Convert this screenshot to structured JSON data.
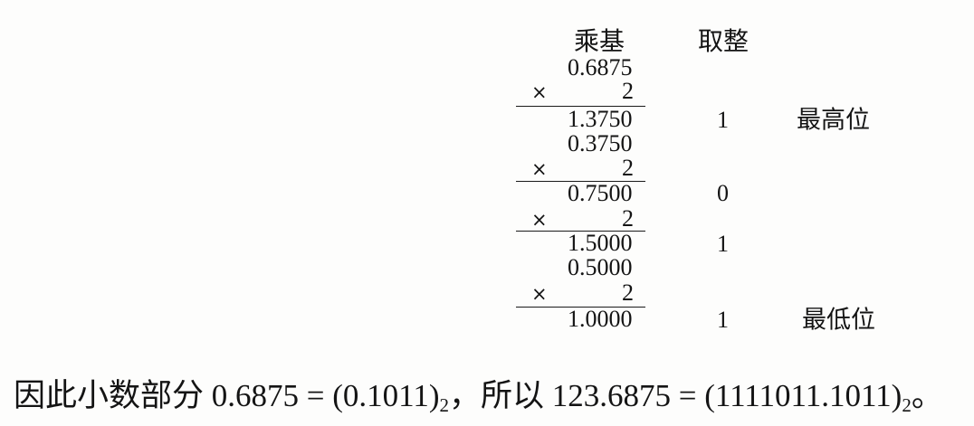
{
  "calc": {
    "header_multiply": "乘基",
    "header_integer": "取整",
    "times_symbol": "×",
    "base": "2",
    "steps": [
      {
        "multiplicand": "0.6875",
        "product": "1.3750",
        "integer": "1",
        "note": "最高位"
      },
      {
        "multiplicand": "0.3750",
        "product": "0.7500",
        "integer": "0"
      },
      {
        "product": "1.5000",
        "integer": "1"
      },
      {
        "multiplicand": "0.5000",
        "product": "1.0000",
        "integer": "1",
        "note": "最低位"
      }
    ]
  },
  "conclusion": {
    "text_1": "因此小数部分 0.6875 = (0.1011)",
    "subscript_1": "2",
    "text_2": "，所以 123.6875 = (1111011.1011)",
    "subscript_2": "2",
    "text_3": "。"
  }
}
